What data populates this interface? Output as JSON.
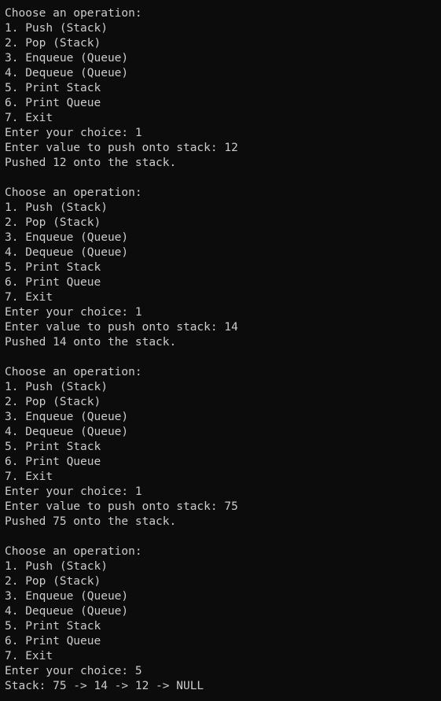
{
  "terminal": {
    "colors": {
      "background": "#0c0c0c",
      "foreground": "#cccccc"
    },
    "lines": [
      "Choose an operation:",
      "1. Push (Stack)",
      "2. Pop (Stack)",
      "3. Enqueue (Queue)",
      "4. Dequeue (Queue)",
      "5. Print Stack",
      "6. Print Queue",
      "7. Exit",
      "Enter your choice: 1",
      "Enter value to push onto stack: 12",
      "Pushed 12 onto the stack.",
      "",
      "Choose an operation:",
      "1. Push (Stack)",
      "2. Pop (Stack)",
      "3. Enqueue (Queue)",
      "4. Dequeue (Queue)",
      "5. Print Stack",
      "6. Print Queue",
      "7. Exit",
      "Enter your choice: 1",
      "Enter value to push onto stack: 14",
      "Pushed 14 onto the stack.",
      "",
      "Choose an operation:",
      "1. Push (Stack)",
      "2. Pop (Stack)",
      "3. Enqueue (Queue)",
      "4. Dequeue (Queue)",
      "5. Print Stack",
      "6. Print Queue",
      "7. Exit",
      "Enter your choice: 1",
      "Enter value to push onto stack: 75",
      "Pushed 75 onto the stack.",
      "",
      "Choose an operation:",
      "1. Push (Stack)",
      "2. Pop (Stack)",
      "3. Enqueue (Queue)",
      "4. Dequeue (Queue)",
      "5. Print Stack",
      "6. Print Queue",
      "7. Exit",
      "Enter your choice: 5",
      "Stack: 75 -> 14 -> 12 -> NULL"
    ]
  }
}
